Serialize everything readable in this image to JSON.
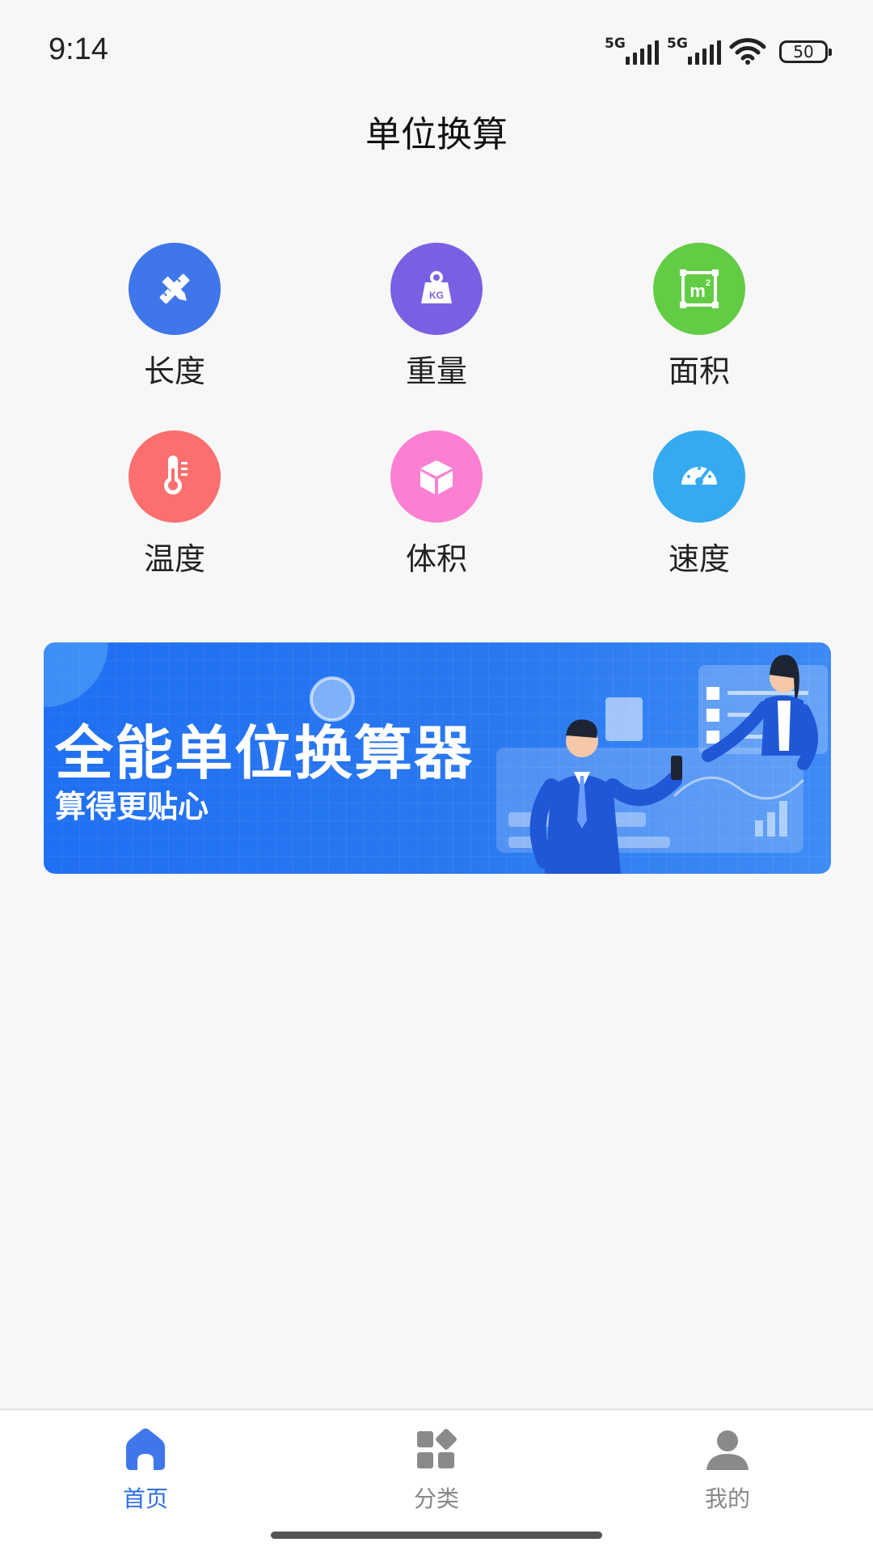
{
  "status_bar": {
    "time": "9:14",
    "network1": "5G",
    "network2": "5G",
    "battery": "50"
  },
  "header": {
    "title": "单位换算"
  },
  "categories": [
    {
      "label": "长度",
      "icon": "ruler-pencil-icon",
      "color": "#3f76ea"
    },
    {
      "label": "重量",
      "icon": "weight-kg-icon",
      "color": "#7b5fe3"
    },
    {
      "label": "面积",
      "icon": "area-m2-icon",
      "color": "#63cc45"
    },
    {
      "label": "温度",
      "icon": "thermometer-icon",
      "color": "#fb6f6f"
    },
    {
      "label": "体积",
      "icon": "cube-icon",
      "color": "#fb7fd2"
    },
    {
      "label": "速度",
      "icon": "speedometer-icon",
      "color": "#35aaf0"
    }
  ],
  "banner": {
    "title": "全能单位换算器",
    "subtitle": "算得更贴心",
    "kg_text": "KG",
    "m2_text": "m²"
  },
  "bottom_nav": {
    "items": [
      {
        "label": "首页",
        "icon": "home-icon",
        "active": true
      },
      {
        "label": "分类",
        "icon": "category-grid-icon",
        "active": false
      },
      {
        "label": "我的",
        "icon": "user-icon",
        "active": false
      }
    ],
    "active_color": "#2f6fe0",
    "inactive_color": "#8a8a8a"
  }
}
